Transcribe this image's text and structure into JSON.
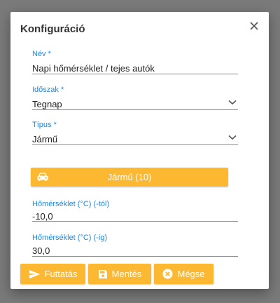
{
  "dialog": {
    "title": "Konfiguráció",
    "close_icon": "close-icon"
  },
  "fields": {
    "name": {
      "label": "Név *",
      "value": "Napi hőmérséklet / tejes autók"
    },
    "period": {
      "label": "Időszak *",
      "value": "Tegnap"
    },
    "type": {
      "label": "Típus *",
      "value": "Jármű"
    },
    "temp_from": {
      "label": "Hőmérséklet (°C) (-tól)",
      "value": "-10,0"
    },
    "temp_to": {
      "label": "Hőmérséklet (°C) (-ig)",
      "value": "30,0"
    }
  },
  "vehicle_button": {
    "label": "Jármű (10)",
    "icon": "car-icon"
  },
  "actions": {
    "run": {
      "label": "Futtatás",
      "icon": "send-icon"
    },
    "save": {
      "label": "Mentés",
      "icon": "save-icon"
    },
    "cancel": {
      "label": "Mégse",
      "icon": "cancel-circle-icon"
    }
  },
  "colors": {
    "accent": "#fbb830",
    "label_blue": "#1e88e5",
    "overlay": "#7a7a7a"
  }
}
